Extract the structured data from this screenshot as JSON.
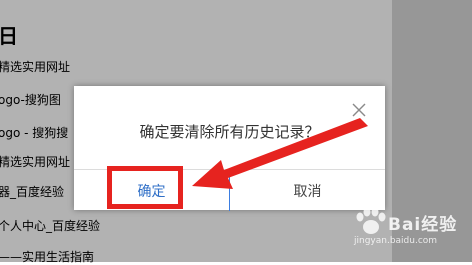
{
  "page": {
    "title_fragment": "日",
    "history_items": [
      "精选实用网址",
      "ogo-搜狗图",
      "ogo - 搜狗搜",
      "精选实用网址",
      "器_百度经验",
      "个人中心_百度经验",
      "——实用生活指南"
    ]
  },
  "dialog": {
    "message": "确定要清除所有历史记录？",
    "confirm_label": "确定",
    "cancel_label": "取消",
    "close_icon": "close-icon"
  },
  "annotation": {
    "color": "#e6231f"
  },
  "watermark": {
    "brand": "Bai",
    "brand_suffix": "经验",
    "url": "jingyan.baidu.com"
  },
  "colors": {
    "accent": "#2f6fc7",
    "divider": "#3b7de1"
  }
}
